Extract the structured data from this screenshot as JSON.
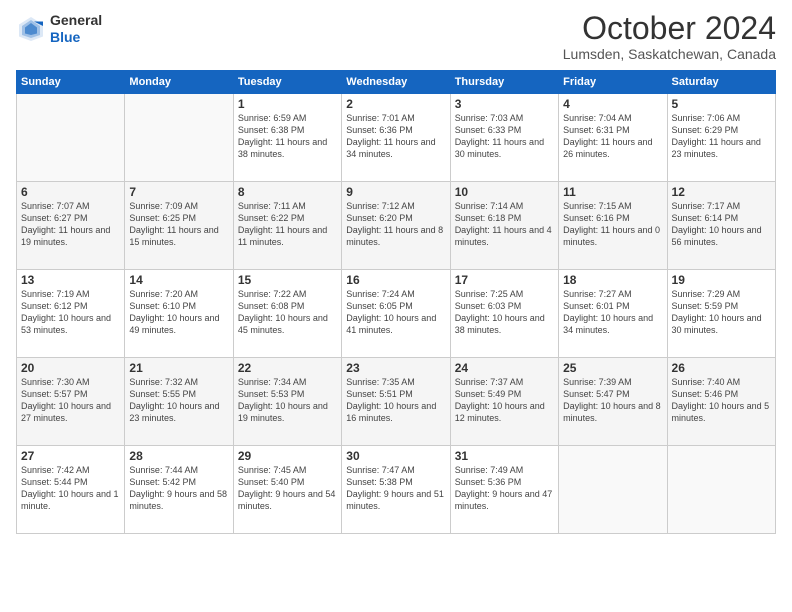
{
  "header": {
    "logo_general": "General",
    "logo_blue": "Blue",
    "month": "October 2024",
    "location": "Lumsden, Saskatchewan, Canada"
  },
  "days_of_week": [
    "Sunday",
    "Monday",
    "Tuesday",
    "Wednesday",
    "Thursday",
    "Friday",
    "Saturday"
  ],
  "weeks": [
    [
      {
        "num": "",
        "info": ""
      },
      {
        "num": "",
        "info": ""
      },
      {
        "num": "1",
        "info": "Sunrise: 6:59 AM\nSunset: 6:38 PM\nDaylight: 11 hours and 38 minutes."
      },
      {
        "num": "2",
        "info": "Sunrise: 7:01 AM\nSunset: 6:36 PM\nDaylight: 11 hours and 34 minutes."
      },
      {
        "num": "3",
        "info": "Sunrise: 7:03 AM\nSunset: 6:33 PM\nDaylight: 11 hours and 30 minutes."
      },
      {
        "num": "4",
        "info": "Sunrise: 7:04 AM\nSunset: 6:31 PM\nDaylight: 11 hours and 26 minutes."
      },
      {
        "num": "5",
        "info": "Sunrise: 7:06 AM\nSunset: 6:29 PM\nDaylight: 11 hours and 23 minutes."
      }
    ],
    [
      {
        "num": "6",
        "info": "Sunrise: 7:07 AM\nSunset: 6:27 PM\nDaylight: 11 hours and 19 minutes."
      },
      {
        "num": "7",
        "info": "Sunrise: 7:09 AM\nSunset: 6:25 PM\nDaylight: 11 hours and 15 minutes."
      },
      {
        "num": "8",
        "info": "Sunrise: 7:11 AM\nSunset: 6:22 PM\nDaylight: 11 hours and 11 minutes."
      },
      {
        "num": "9",
        "info": "Sunrise: 7:12 AM\nSunset: 6:20 PM\nDaylight: 11 hours and 8 minutes."
      },
      {
        "num": "10",
        "info": "Sunrise: 7:14 AM\nSunset: 6:18 PM\nDaylight: 11 hours and 4 minutes."
      },
      {
        "num": "11",
        "info": "Sunrise: 7:15 AM\nSunset: 6:16 PM\nDaylight: 11 hours and 0 minutes."
      },
      {
        "num": "12",
        "info": "Sunrise: 7:17 AM\nSunset: 6:14 PM\nDaylight: 10 hours and 56 minutes."
      }
    ],
    [
      {
        "num": "13",
        "info": "Sunrise: 7:19 AM\nSunset: 6:12 PM\nDaylight: 10 hours and 53 minutes."
      },
      {
        "num": "14",
        "info": "Sunrise: 7:20 AM\nSunset: 6:10 PM\nDaylight: 10 hours and 49 minutes."
      },
      {
        "num": "15",
        "info": "Sunrise: 7:22 AM\nSunset: 6:08 PM\nDaylight: 10 hours and 45 minutes."
      },
      {
        "num": "16",
        "info": "Sunrise: 7:24 AM\nSunset: 6:05 PM\nDaylight: 10 hours and 41 minutes."
      },
      {
        "num": "17",
        "info": "Sunrise: 7:25 AM\nSunset: 6:03 PM\nDaylight: 10 hours and 38 minutes."
      },
      {
        "num": "18",
        "info": "Sunrise: 7:27 AM\nSunset: 6:01 PM\nDaylight: 10 hours and 34 minutes."
      },
      {
        "num": "19",
        "info": "Sunrise: 7:29 AM\nSunset: 5:59 PM\nDaylight: 10 hours and 30 minutes."
      }
    ],
    [
      {
        "num": "20",
        "info": "Sunrise: 7:30 AM\nSunset: 5:57 PM\nDaylight: 10 hours and 27 minutes."
      },
      {
        "num": "21",
        "info": "Sunrise: 7:32 AM\nSunset: 5:55 PM\nDaylight: 10 hours and 23 minutes."
      },
      {
        "num": "22",
        "info": "Sunrise: 7:34 AM\nSunset: 5:53 PM\nDaylight: 10 hours and 19 minutes."
      },
      {
        "num": "23",
        "info": "Sunrise: 7:35 AM\nSunset: 5:51 PM\nDaylight: 10 hours and 16 minutes."
      },
      {
        "num": "24",
        "info": "Sunrise: 7:37 AM\nSunset: 5:49 PM\nDaylight: 10 hours and 12 minutes."
      },
      {
        "num": "25",
        "info": "Sunrise: 7:39 AM\nSunset: 5:47 PM\nDaylight: 10 hours and 8 minutes."
      },
      {
        "num": "26",
        "info": "Sunrise: 7:40 AM\nSunset: 5:46 PM\nDaylight: 10 hours and 5 minutes."
      }
    ],
    [
      {
        "num": "27",
        "info": "Sunrise: 7:42 AM\nSunset: 5:44 PM\nDaylight: 10 hours and 1 minute."
      },
      {
        "num": "28",
        "info": "Sunrise: 7:44 AM\nSunset: 5:42 PM\nDaylight: 9 hours and 58 minutes."
      },
      {
        "num": "29",
        "info": "Sunrise: 7:45 AM\nSunset: 5:40 PM\nDaylight: 9 hours and 54 minutes."
      },
      {
        "num": "30",
        "info": "Sunrise: 7:47 AM\nSunset: 5:38 PM\nDaylight: 9 hours and 51 minutes."
      },
      {
        "num": "31",
        "info": "Sunrise: 7:49 AM\nSunset: 5:36 PM\nDaylight: 9 hours and 47 minutes."
      },
      {
        "num": "",
        "info": ""
      },
      {
        "num": "",
        "info": ""
      }
    ]
  ]
}
